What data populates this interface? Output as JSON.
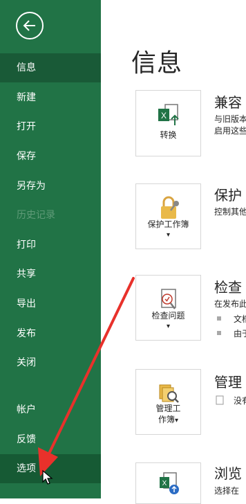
{
  "sidebar": {
    "items": [
      {
        "label": "信息"
      },
      {
        "label": "新建"
      },
      {
        "label": "打开"
      },
      {
        "label": "保存"
      },
      {
        "label": "另存为"
      },
      {
        "label": "历史记录"
      },
      {
        "label": "打印"
      },
      {
        "label": "共享"
      },
      {
        "label": "导出"
      },
      {
        "label": "发布"
      },
      {
        "label": "关闭"
      },
      {
        "label": "帐户"
      },
      {
        "label": "反馈"
      },
      {
        "label": "选项"
      }
    ],
    "active": "信息",
    "disabled": "历史记录"
  },
  "main": {
    "title": "信息",
    "sections": [
      {
        "button_label": "转换",
        "title": "兼容",
        "desc1": "与旧版本",
        "desc2": "启用这些"
      },
      {
        "button_label_line1": "保护工作簿",
        "title": "保护",
        "desc1": "控制其他"
      },
      {
        "button_label_line1": "检查问题",
        "title": "检查",
        "desc1": "在发布此",
        "bullet1": "文档",
        "bullet2": "由于"
      },
      {
        "button_label_line1": "管理工",
        "button_label_line2": "作簿",
        "title": "管理",
        "desc1": "没有"
      },
      {
        "title": "浏览",
        "desc1": "选择在"
      }
    ]
  },
  "colors": {
    "sidebar": "#217346",
    "active": "#195a37",
    "arrow": "#e8312b"
  }
}
